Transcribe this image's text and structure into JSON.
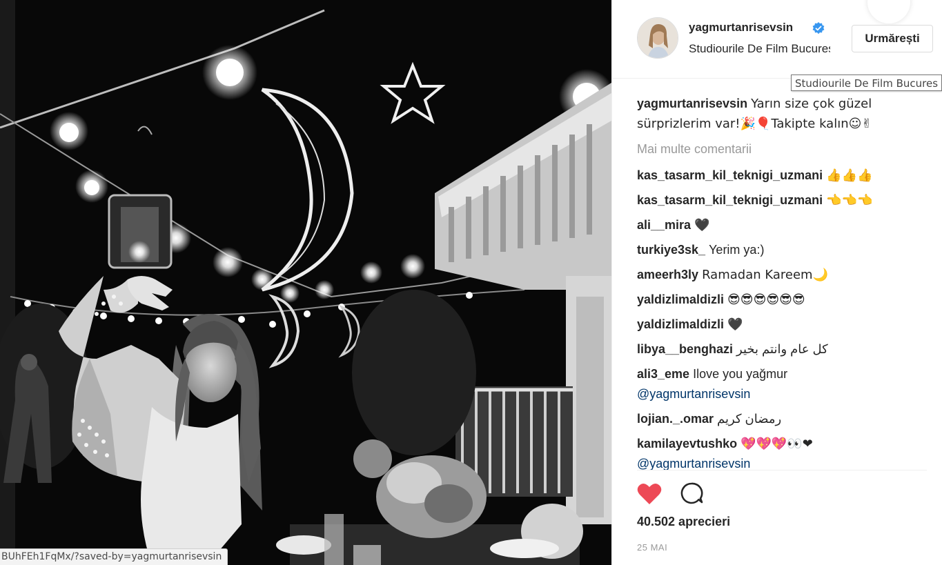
{
  "post": {
    "username": "yagmurtanrisevsin",
    "location": "Studiourile De Film Bucuresti",
    "location_tooltip": "Studiourile De Film Bucures",
    "follow_label": "Urmărești",
    "status_url": "BUhFEh1FqMx/?saved-by=yagmurtanrisevsin",
    "caption": {
      "user": "yagmurtanrisevsin",
      "text": "Yarın size çok güzel sürprizlerim var!🎉🎈Takipte kalın☺✌"
    },
    "more_comments": "Mai multe comentarii",
    "comments": [
      {
        "user": "kas_tasarm_kil_teknigi_uzmani",
        "text": "👍👍👍"
      },
      {
        "user": "kas_tasarm_kil_teknigi_uzmani",
        "text": "👈👈👈"
      },
      {
        "user": "ali__mira",
        "text": "🖤"
      },
      {
        "user": "turkiye3sk_",
        "text": "Yerim ya:)"
      },
      {
        "user": "ameerh3ly",
        "text": "Ramadan Kareem🌙"
      },
      {
        "user": "yaldizlimaldizli",
        "text": "😎😎😎😎😎😎"
      },
      {
        "user": "yaldizlimaldizli",
        "text": "🖤"
      },
      {
        "user": "libya__benghazi",
        "text": "كل عام وانتم بخير"
      },
      {
        "user": "ali3_eme",
        "text": "Ilove you yağmur",
        "mention": "@yagmurtanrisevsin"
      },
      {
        "user": "lojian._.omar",
        "text": "رمضان كريم"
      },
      {
        "user": "kamilayevtushko",
        "text": "💖💖💖👀❤",
        "mention": "@yagmurtanrisevsin"
      }
    ],
    "likes": "40.502 aprecieri",
    "date": "25 MAI",
    "icons": {
      "like": "heart-filled-icon",
      "comment": "speech-bubble-icon",
      "verified": "verified-badge-icon"
    },
    "colors": {
      "like": "#ed4956",
      "verified": "#3897f0",
      "mention": "#003569",
      "muted": "#999999"
    }
  }
}
